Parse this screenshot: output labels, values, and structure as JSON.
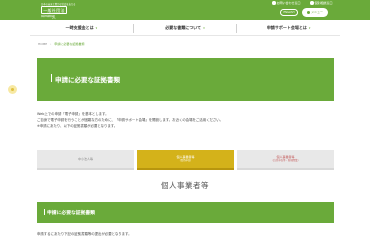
{
  "header": {
    "logo_sub_top": "日本の未来と豊かな社会を支える",
    "logo_main": "一般社団法人",
    "logo_sub_bottom": "事業再構築協会",
    "links": [
      "お問い合わせ窓口",
      "個別相談窓口"
    ],
    "lang_button": "ENGLISH",
    "menu_button": "メニュー"
  },
  "nav": {
    "items": [
      "一時支援金とは",
      "必要な書類について",
      "申請サポート会場とは"
    ]
  },
  "breadcrumb": {
    "home": "HOME",
    "current": "申請に必要な証拠書類"
  },
  "hero": {
    "title": "申請に必要な証拠書類"
  },
  "intro": {
    "lines": [
      "Web上での申請「電子申請」を基本とします。",
      "ご自身で電子申請を行うことが困難な方のために、「申請サポート会場」を開設します。お近くの会場をご活用ください。",
      "※申請にあたり、以下の証拠書類が必要となります。"
    ]
  },
  "tabs": [
    {
      "label": "中小法人等",
      "sub": ""
    },
    {
      "label": "個人事業者等",
      "sub": "(青色申告)"
    },
    {
      "label": "個人事業者等",
      "sub": "(白色申告等・新規開業)"
    }
  ],
  "section": {
    "heading": "個人事業者等",
    "band_title": "申請に必要な証拠書類",
    "body": "申請するにあたり下記の証拠書類等の提出が必要となります。"
  },
  "colors": {
    "brand_green": "#6aaa3a",
    "active_tab": "#d4b21a"
  }
}
